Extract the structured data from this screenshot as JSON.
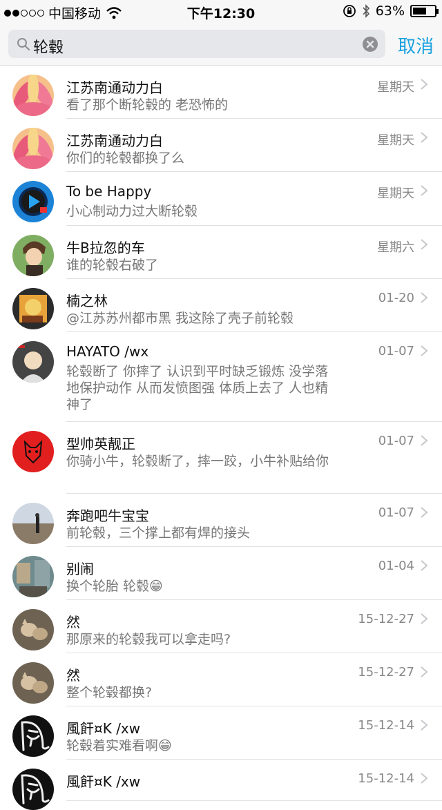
{
  "status_bar": {
    "carrier": "中国移动",
    "time": "下午12:30",
    "battery": "63%",
    "battery_level": 0.63
  },
  "search": {
    "query": "轮毂",
    "cancel_label": "取消"
  },
  "results": [
    {
      "name": "江苏南通动力白",
      "message": "看了那个断轮毂的 老恐怖的",
      "date": "星期天",
      "avatar": "flower-avatar"
    },
    {
      "name": "江苏南通动力白",
      "message": "你们的轮毂都换了么",
      "date": "星期天",
      "avatar": "flower-avatar"
    },
    {
      "name": "To be Happy",
      "message": "小心制动力过大断轮毂",
      "date": "星期天",
      "avatar": "play-logo-avatar"
    },
    {
      "name": "牛B拉忽的车",
      "message": "谁的轮毂右破了",
      "date": "星期六",
      "avatar": "anime-boy-avatar"
    },
    {
      "name": "楠之林",
      "message": "@江苏苏州都市黑 我这除了壳子前轮毂",
      "date": "01-20",
      "avatar": "cartoon-avatar"
    },
    {
      "name": "HAYATO /wx",
      "message": "轮毂断了 你摔了 认识到平时缺乏锻炼 没学落地保护动作 从而发愤图强 体质上去了 人也精神了",
      "date": "01-07",
      "avatar": "bald-hero-avatar"
    },
    {
      "name": "型帅英靓正",
      "message": "你骑小牛，轮毂断了，摔一跤，小牛补贴给你",
      "date": "01-07",
      "avatar": "red-beast-avatar"
    },
    {
      "name": "奔跑吧牛宝宝",
      "message": "前轮毂，三个撑上都有焊的接头",
      "date": "01-07",
      "avatar": "beach-avatar"
    },
    {
      "name": "别闹",
      "message": "换个轮胎 轮毂😁",
      "date": "01-04",
      "avatar": "street-avatar"
    },
    {
      "name": "然",
      "message": "那原来的轮毂我可以拿走吗?",
      "date": "15-12-27",
      "avatar": "cat-avatar"
    },
    {
      "name": "然",
      "message": "整个轮毂都换?",
      "date": "15-12-27",
      "avatar": "cat-avatar"
    },
    {
      "name": "風飦¤K /xw",
      "message": "轮毂着实难看啊😁",
      "date": "15-12-14",
      "avatar": "calligraphy-avatar"
    },
    {
      "name": "風飦¤K /xw",
      "message": "",
      "date": "15-12-14",
      "avatar": "calligraphy-avatar"
    }
  ]
}
